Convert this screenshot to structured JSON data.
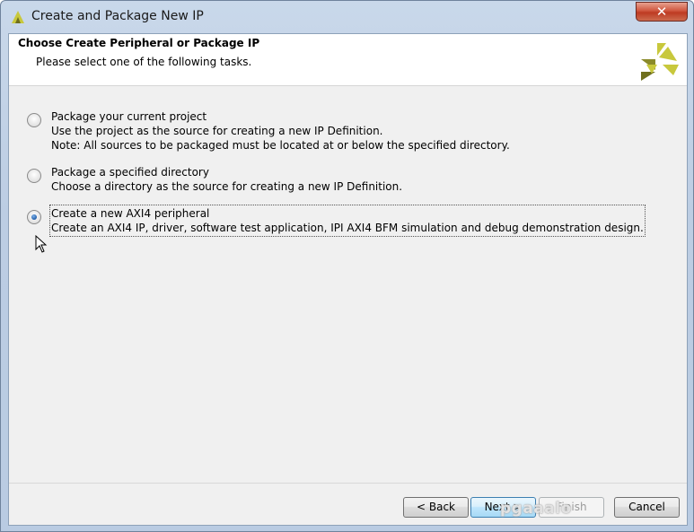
{
  "window": {
    "title": "Create and Package New IP",
    "close_glyph": "✕"
  },
  "header": {
    "title": "Choose Create Peripheral or Package IP",
    "subtitle": "Please select one of the following tasks."
  },
  "options": [
    {
      "label": "Package your current project",
      "lines": [
        "Use the project as the source for creating a new IP Definition.",
        "Note: All sources to be packaged must be located at or below the specified directory."
      ],
      "selected": false
    },
    {
      "label": "Package a specified directory",
      "lines": [
        "Choose a directory as the source for creating a new IP Definition."
      ],
      "selected": false
    },
    {
      "label": "Create a new AXI4 peripheral",
      "lines": [
        "Create  an AXI4 IP, driver, software test application, IPI AXI4 BFM simulation and debug demonstration design."
      ],
      "selected": true
    }
  ],
  "buttons": {
    "back": "< Back",
    "next": "Next >",
    "finish": "Finish",
    "cancel": "Cancel"
  },
  "watermark": "pgaaalo",
  "colors": {
    "logo_light": "#c8c83c",
    "logo_dark": "#6f6f1e",
    "close_red": "#c8452c",
    "radio_dot": "#1f5ca8"
  }
}
